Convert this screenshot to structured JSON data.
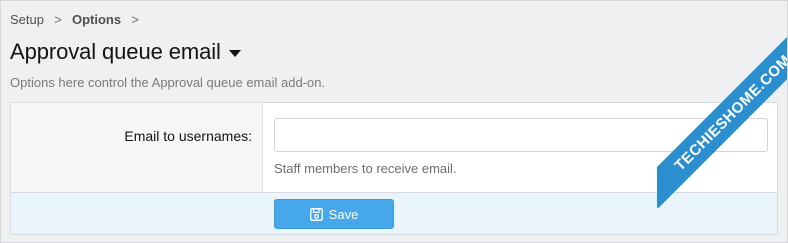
{
  "breadcrumb": {
    "items": [
      "Setup",
      "Options"
    ],
    "separator": ">"
  },
  "page": {
    "title": "Approval queue email",
    "description": "Options here control the Approval queue email add-on."
  },
  "form": {
    "email_field": {
      "label": "Email to usernames:",
      "value": "",
      "explain": "Staff members to receive email."
    },
    "save_label": "Save"
  },
  "watermark": {
    "text": "TECHIESHOME.COM"
  },
  "colors": {
    "accent": "#47a7eb",
    "submit_row_bg": "#eaf4fb",
    "label_col_bg": "#f5f6f7",
    "watermark_band": "#2b8fcf"
  },
  "icons": {
    "title_menu": "caret-down-icon",
    "save": "save-icon",
    "breadcrumb_sep": "chevron-right-icon"
  }
}
